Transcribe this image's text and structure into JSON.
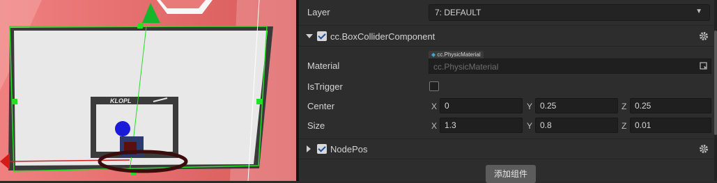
{
  "inspector": {
    "layer": {
      "label": "Layer",
      "value": "7: DEFAULT"
    },
    "box_collider": {
      "title": "cc.BoxColliderComponent",
      "enabled": true,
      "material": {
        "label": "Material",
        "tag": "cc.PhysicMaterial",
        "placeholder": "cc.PhysicMaterial"
      },
      "is_trigger": {
        "label": "IsTrigger",
        "checked": false
      },
      "center": {
        "label": "Center",
        "x_axis": "X",
        "y_axis": "Y",
        "z_axis": "Z",
        "x": "0",
        "y": "0.25",
        "z": "0.25"
      },
      "size": {
        "label": "Size",
        "x_axis": "X",
        "y_axis": "Y",
        "z_axis": "Z",
        "x": "1.3",
        "y": "0.8",
        "z": "0.01"
      }
    },
    "node_pos": {
      "title": "NodePos",
      "enabled": true
    },
    "add_component_label": "添加组件"
  },
  "scene_view": {
    "backboard_logo": "KLOPL",
    "colors": {
      "selection_green": "#22e022",
      "background_red": "#e66d6d",
      "backboard": "#e5e5e5",
      "frame": "#3b3b3b"
    }
  }
}
